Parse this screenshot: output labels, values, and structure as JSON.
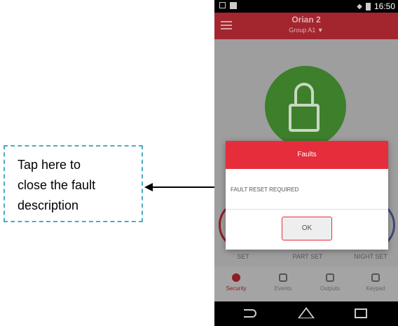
{
  "callout": {
    "text": "Tap here to\nclose the fault\ndescription"
  },
  "status_bar": {
    "time": "16:50"
  },
  "app_bar": {
    "title": "Orian 2",
    "subtitle": "Group A1 ▼"
  },
  "modes": [
    {
      "label": "SET"
    },
    {
      "label": "PART SET"
    },
    {
      "label": "NIGHT SET"
    }
  ],
  "bottom_nav": [
    {
      "label": "Security",
      "icon": "shield-icon",
      "active": true
    },
    {
      "label": "Events",
      "icon": "bell-icon",
      "active": false
    },
    {
      "label": "Outputs",
      "icon": "toggle-icon",
      "active": false
    },
    {
      "label": "Keypad",
      "icon": "keypad-icon",
      "active": false
    }
  ],
  "dialog": {
    "title": "Faults",
    "message": "FAULT RESET REQUIRED",
    "ok_label": "OK"
  },
  "colors": {
    "app_bar": "#a3262f",
    "dialog_header": "#e52d3b",
    "callout_border": "#4bacc6",
    "lock_circle": "#3d7f2a"
  }
}
